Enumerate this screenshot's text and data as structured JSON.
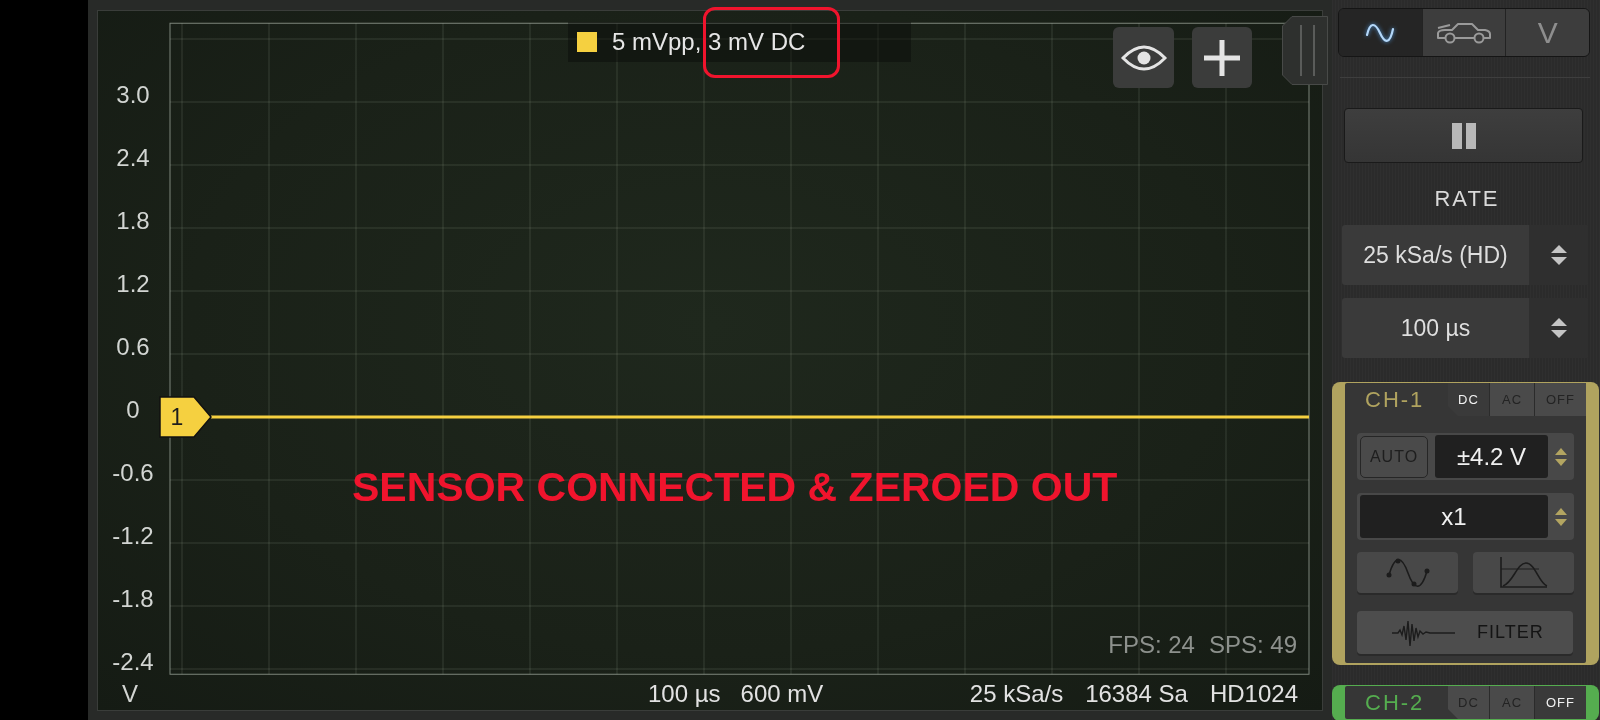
{
  "scope": {
    "legend": {
      "text": "5 mVpp, 3 mV DC"
    },
    "chart_data": {
      "type": "line",
      "ylabel": "V",
      "ylim": [
        -2.45,
        3.75
      ],
      "yticks": [
        {
          "value": 3,
          "label": "3.0"
        },
        2.4,
        1.8,
        1.2,
        0.6,
        0,
        -0.6,
        -1.2,
        -1.8,
        -2.4
      ],
      "grid": true,
      "series": [
        {
          "name": "1",
          "color": "#f5d040",
          "values": [
            0,
            0,
            0,
            0,
            0,
            0,
            0,
            0,
            0,
            0,
            0,
            0,
            0
          ]
        }
      ]
    },
    "stats": [
      "FPS: 24",
      "SPS: 49"
    ],
    "status_bar": {
      "left": [
        "100 µs",
        "600 mV"
      ],
      "right": [
        "25 kSa/s",
        "16384 Sa",
        "HD1024"
      ]
    }
  },
  "annotations": [
    {
      "kind": "rectangle"
    },
    {
      "kind": "text",
      "text": "SENSOR CONNECTED & ZEROED OUT"
    }
  ],
  "mode_tabs": [
    {
      "kind": "wave",
      "selected": true
    },
    {
      "kind": "car",
      "selected": false
    },
    {
      "kind": "text",
      "label": "V",
      "selected": false
    }
  ],
  "rate": {
    "label": "RATE",
    "selectors": [
      {
        "value": "25 kSa/s (HD)"
      },
      {
        "value": "100 µs"
      }
    ]
  },
  "channels": [
    {
      "name": "CH-1",
      "color": "#b0a35f",
      "couplings": [
        {
          "label": "DC",
          "selected": true
        },
        {
          "label": "AC",
          "selected": false
        },
        {
          "label": "OFF",
          "selected": false
        }
      ],
      "auto_button": "AUTO",
      "range": "±4.2 V",
      "probe": "x1",
      "filter_button": "FILTER"
    },
    {
      "name": "CH-2",
      "color": "#55ad4f",
      "couplings": [
        {
          "label": "DC",
          "selected": false
        },
        {
          "label": "AC",
          "selected": false
        },
        {
          "label": "OFF",
          "selected": true
        }
      ]
    }
  ]
}
